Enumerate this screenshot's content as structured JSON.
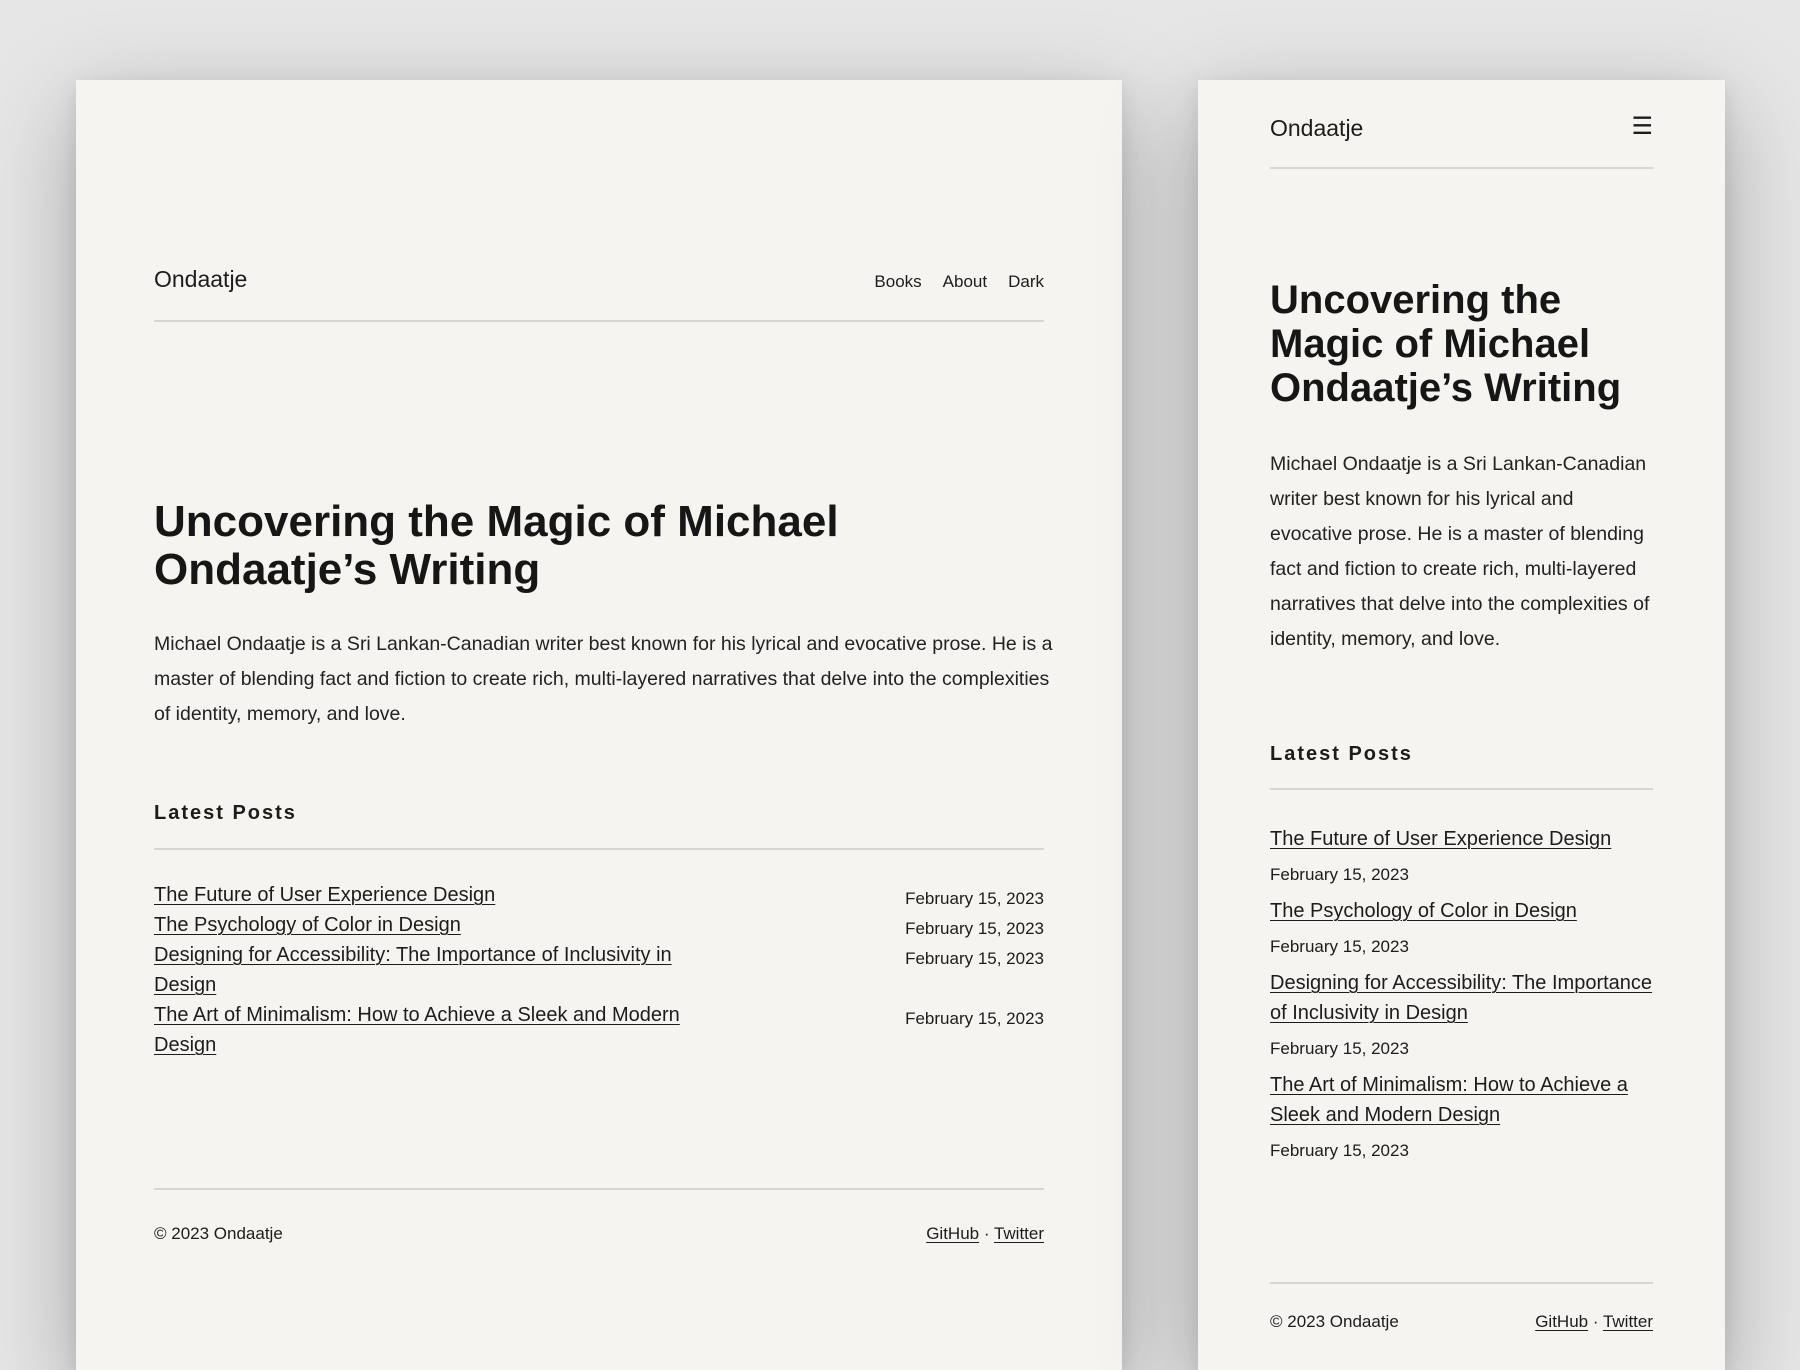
{
  "site": {
    "brand": "Ondaatje"
  },
  "nav": {
    "books": "Books",
    "about": "About",
    "dark": "Dark"
  },
  "mobile_menu_icon": "☰",
  "hero": {
    "title": "Uncovering the Magic of Michael Ondaatje’s Writing",
    "intro": "Michael Ondaatje is a Sri Lankan-Canadian writer best known for his lyrical and evocative prose. He is a master of blending fact and fiction to create rich, multi-layered narratives that delve into the complexities of identity, memory, and love."
  },
  "latest": {
    "heading": "Latest Posts",
    "posts": [
      {
        "title": "The Future of User Experience Design",
        "date": "February 15, 2023"
      },
      {
        "title": "The Psychology of Color in Design",
        "date": "February 15, 2023"
      },
      {
        "title": "Designing for Accessibility: The Importance of Inclusivity in Design",
        "date": "February 15, 2023"
      },
      {
        "title": "The Art of Minimalism: How to Achieve a Sleek and Modern Design",
        "date": "February 15, 2023"
      }
    ]
  },
  "footer": {
    "copyright": "© 2023 Ondaatje",
    "github": "GitHub",
    "separator": "·",
    "twitter": "Twitter"
  }
}
